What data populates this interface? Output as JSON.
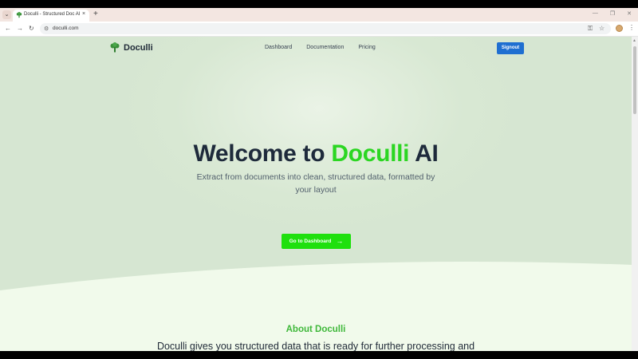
{
  "browser": {
    "tab_title": "Doculli - Structured Doc AI",
    "tab_close": "×",
    "new_tab": "+",
    "url": "doculli.com"
  },
  "header": {
    "logo_text": "Doculli",
    "nav": [
      "Dashboard",
      "Documentation",
      "Pricing"
    ],
    "signout_label": "Signout"
  },
  "hero": {
    "title_before": "Welcome to ",
    "title_brand": "Doculli",
    "title_after": " AI",
    "subtitle": "Extract from documents into clean, structured data, formatted by your layout",
    "cta_label": "Go to Dashboard"
  },
  "about": {
    "heading": "About Doculli",
    "text": "Doculli gives you structured data that is ready for further processing and automations"
  },
  "colors": {
    "brand_green": "#2bd622",
    "cta_green": "#1fe00e",
    "signout_blue": "#1f6fd1",
    "heading_dark": "#1e2a3b"
  },
  "icons": {
    "logo": "broccoli-tree-icon",
    "cta": "arrow-right-icon"
  }
}
